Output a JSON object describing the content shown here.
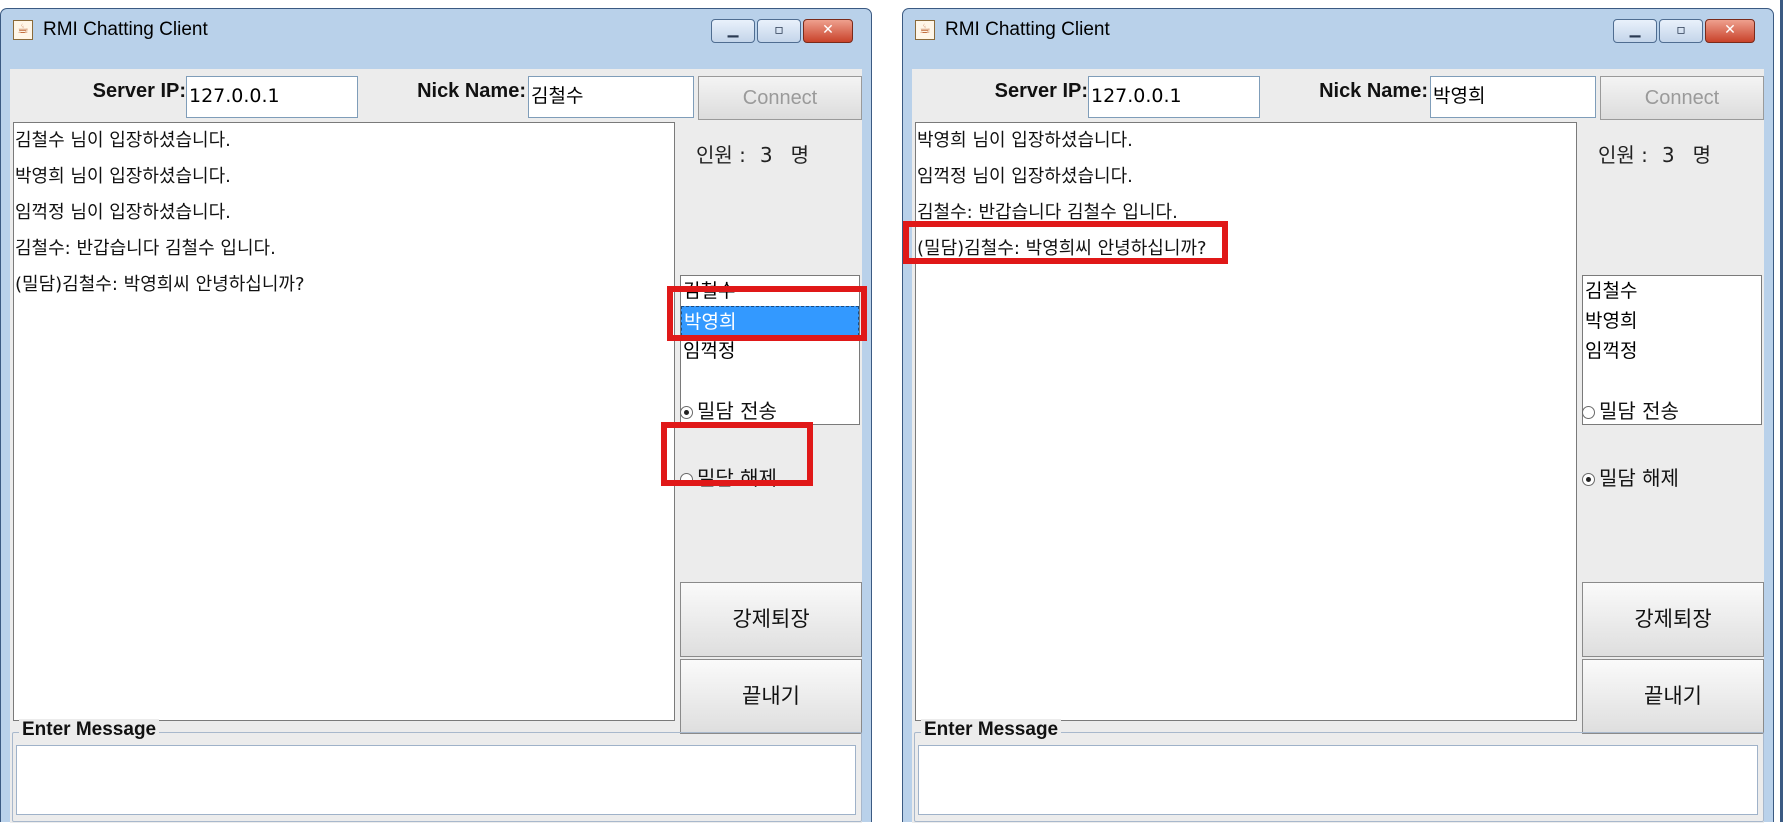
{
  "windows": [
    {
      "title": "RMI Chatting Client",
      "server_ip_label": "Server IP:",
      "server_ip_value": "127.0.0.1",
      "nick_label": "Nick Name:",
      "nick_value": "김철수",
      "connect_label": "Connect",
      "messages": [
        "김철수 님이 입장하셨습니다.",
        "박영희 님이 입장하셨습니다.",
        "임꺽정 님이 입장하셨습니다.",
        "김철수: 반갑습니다 김철수 입니다.",
        "(밀담)김철수: 박영희씨 안녕하십니까?"
      ],
      "count_label": "인원 :",
      "count_value": "3",
      "count_unit": "명",
      "users": [
        "김철수",
        "박영희",
        "임꺽정"
      ],
      "selected_user": "박영희",
      "radio_whisper_send": "밀담 전송",
      "radio_whisper_cancel": "밀담 해제",
      "whisper_mode": "send",
      "kick_label": "강제퇴장",
      "exit_label": "끝내기",
      "enter_message_label": "Enter Message"
    },
    {
      "title": "RMI Chatting Client",
      "server_ip_label": "Server IP:",
      "server_ip_value": "127.0.0.1",
      "nick_label": "Nick Name:",
      "nick_value": "박영희",
      "connect_label": "Connect",
      "messages": [
        "박영희 님이 입장하셨습니다.",
        "임꺽정 님이 입장하셨습니다.",
        "김철수: 반갑습니다 김철수 입니다.",
        "(밀담)김철수: 박영희씨 안녕하십니까?"
      ],
      "count_label": "인원 :",
      "count_value": "3",
      "count_unit": "명",
      "users": [
        "김철수",
        "박영희",
        "임꺽정"
      ],
      "selected_user": "",
      "radio_whisper_send": "밀담 전송",
      "radio_whisper_cancel": "밀담 해제",
      "whisper_mode": "cancel",
      "kick_label": "강제퇴장",
      "exit_label": "끝내기",
      "enter_message_label": "Enter Message"
    }
  ],
  "colors": {
    "highlight": "#e01818",
    "selection": "#3399ff",
    "window_frame": "#b9d1ea"
  }
}
